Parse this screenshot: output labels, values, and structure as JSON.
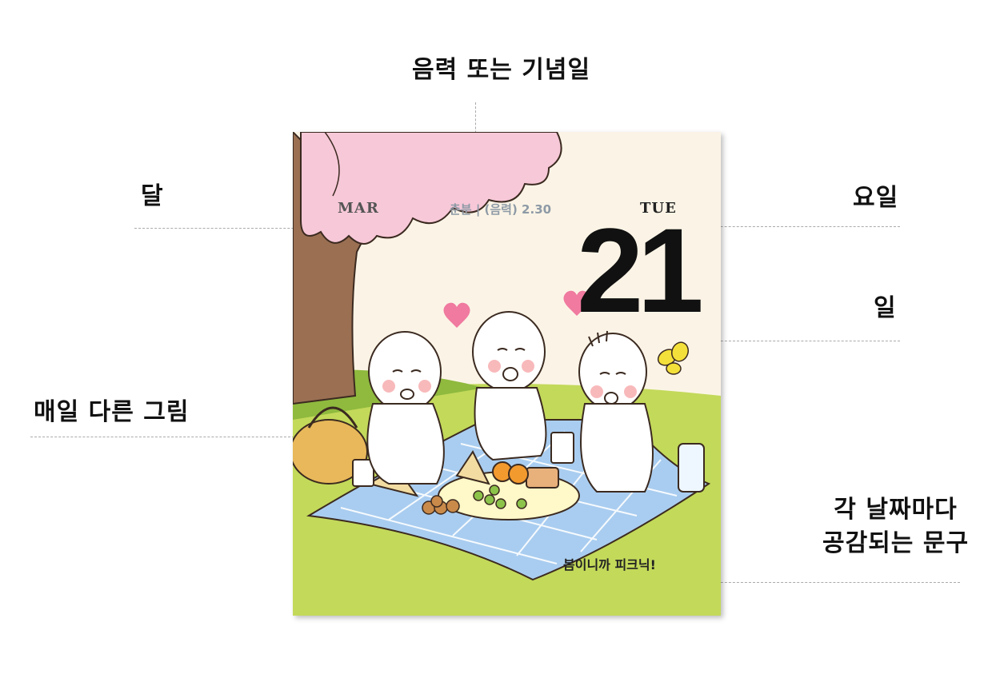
{
  "annotations": {
    "lunar_or_anniversary": "음력 또는 기념일",
    "month": "달",
    "weekday": "요일",
    "day": "일",
    "daily_picture": "매일 다른 그림",
    "daily_phrase": "각 날짜마다\n공감되는 문구"
  },
  "card": {
    "month": "MAR",
    "lunar_text": "춘분 | (음력) 2.30",
    "weekday": "TUE",
    "day": "21",
    "phrase": "봄이니까 피크닉!"
  },
  "colors": {
    "sky": "#fbf4e6",
    "blossom": "#f7c8d8",
    "trunk": "#9a6f52",
    "grass": "#c3d95a",
    "blanket": "#a9cdf0",
    "heart": "#f07aa0",
    "butterfly": "#f4e03a"
  }
}
